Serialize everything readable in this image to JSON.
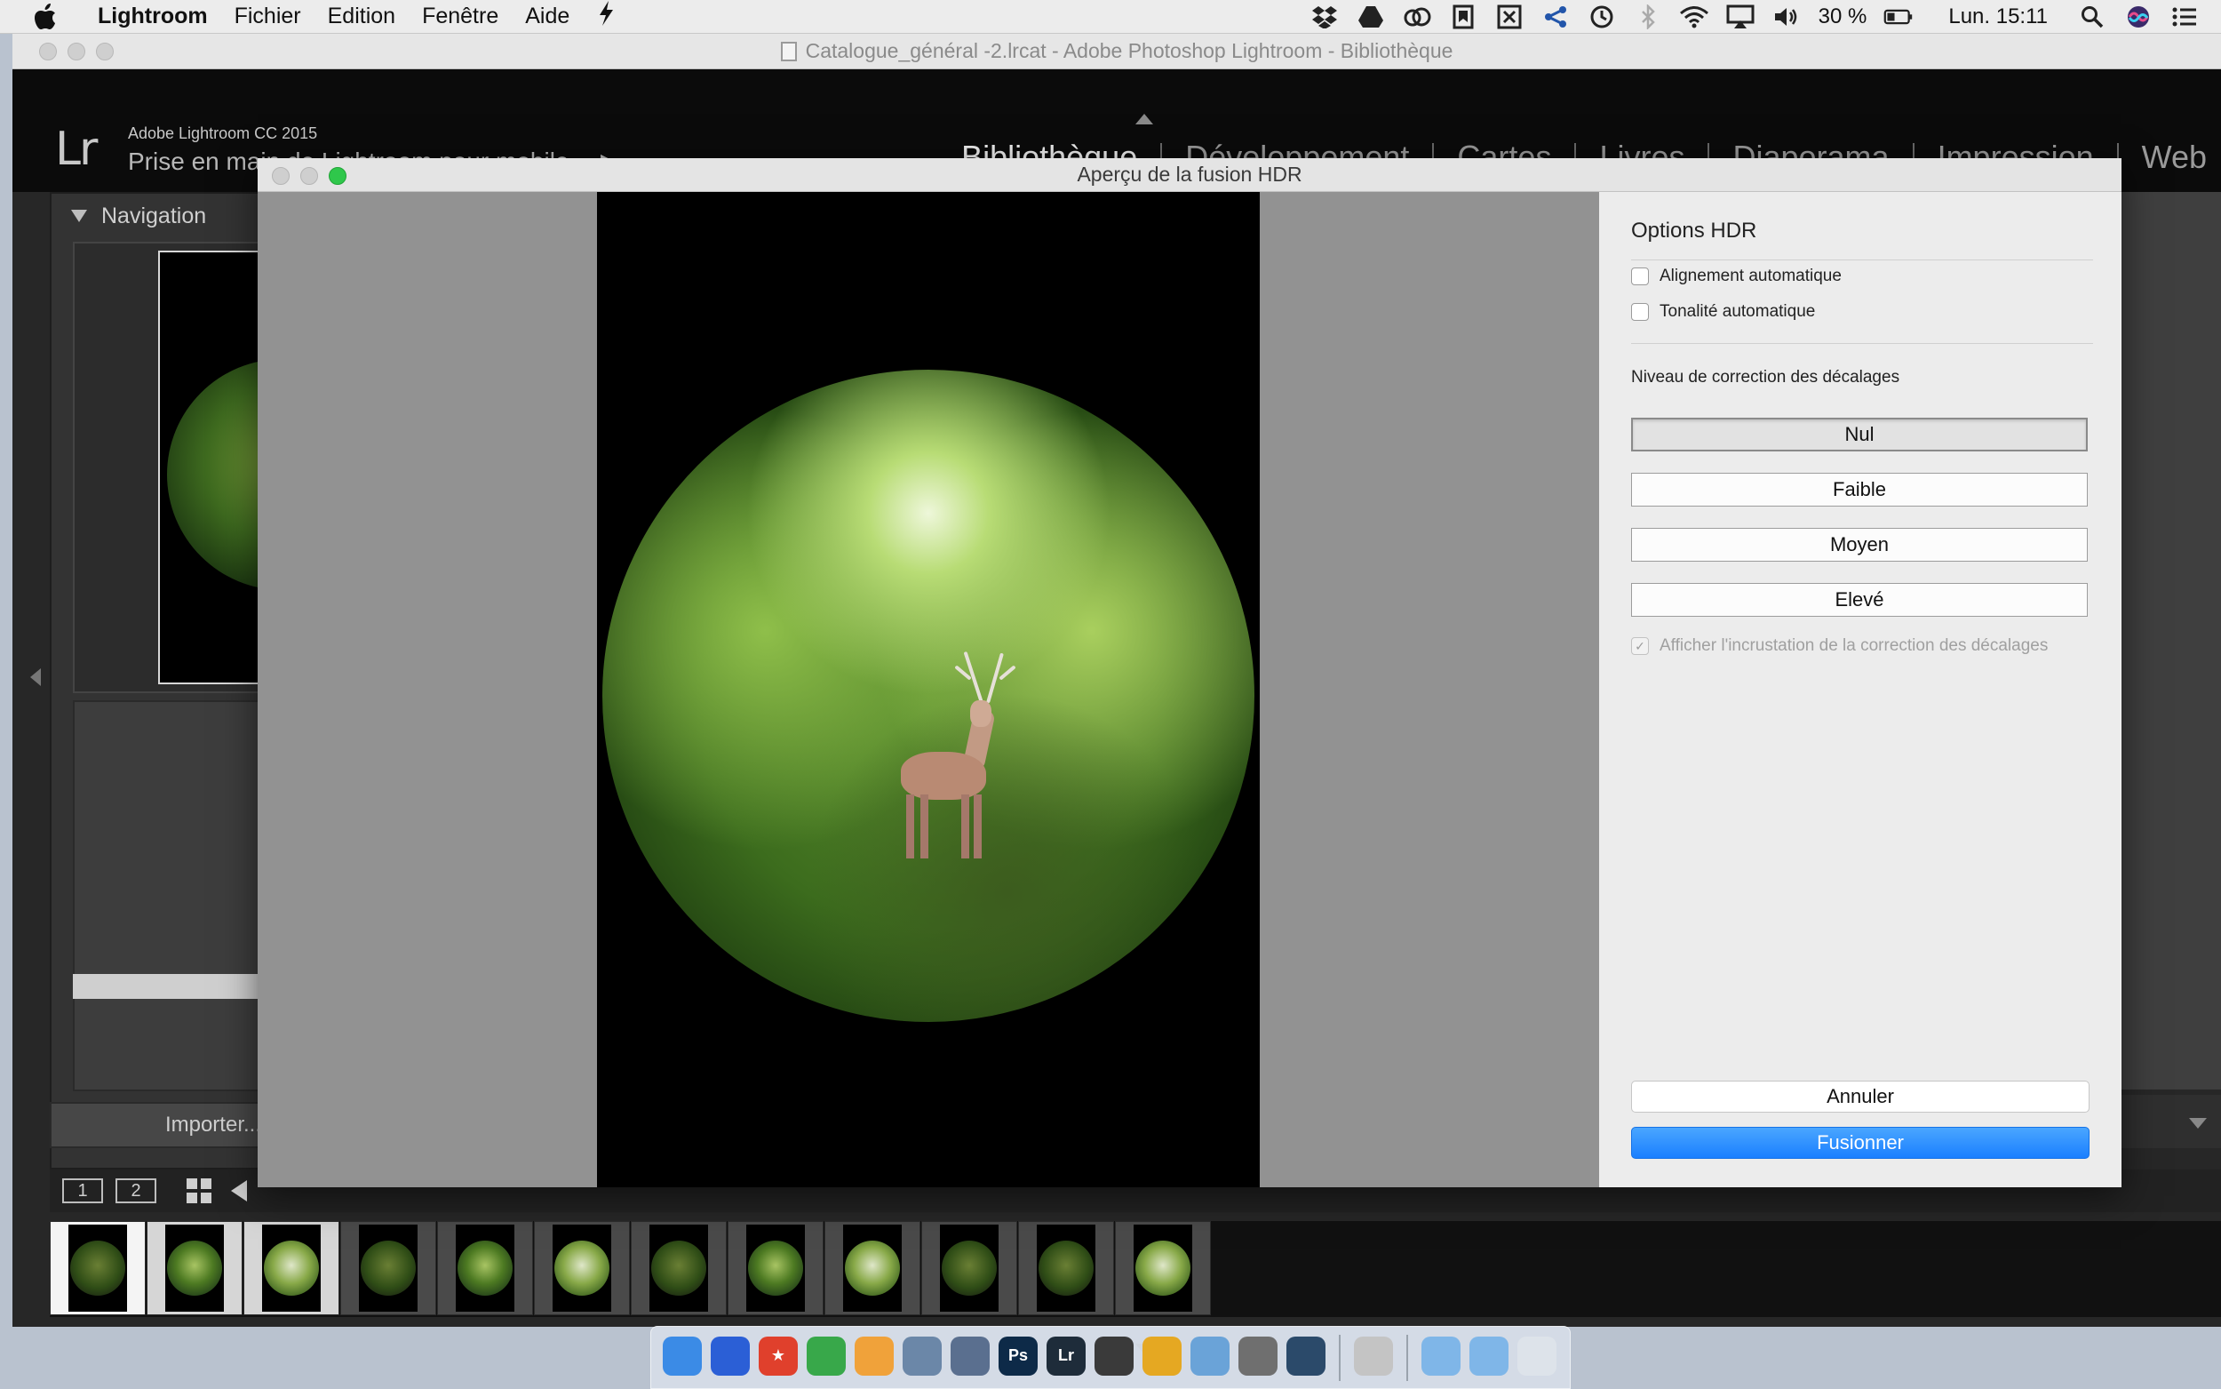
{
  "menubar": {
    "app": "Lightroom",
    "items": [
      "Fichier",
      "Edition",
      "Fenêtre",
      "Aide"
    ],
    "battery": "30 %",
    "clock": "Lun. 15:11"
  },
  "window": {
    "title": "Catalogue_général -2.lrcat - Adobe Photoshop Lightroom - Bibliothèque"
  },
  "header": {
    "logo": "Lr",
    "product": "Adobe Lightroom CC 2015",
    "identity": "Prise en main de Lightroom pour mobile",
    "arrow": "▶",
    "modules": [
      "Bibliothèque",
      "Développement",
      "Cartes",
      "Livres",
      "Diaporama",
      "Impression",
      "Web"
    ],
    "active_module": "Bibliothèque"
  },
  "left_panel": {
    "navigation_title": "Navigation",
    "import_label": "Importer..."
  },
  "filmstrip": {
    "view_buttons": [
      "1",
      "2"
    ],
    "thumbs": [
      {
        "state": "primary",
        "tone": "dark"
      },
      {
        "state": "selected",
        "tone": "normal"
      },
      {
        "state": "selected",
        "tone": "light"
      },
      {
        "state": "none",
        "tone": "dark"
      },
      {
        "state": "none",
        "tone": "normal"
      },
      {
        "state": "none",
        "tone": "light"
      },
      {
        "state": "none",
        "tone": "dark"
      },
      {
        "state": "none",
        "tone": "normal"
      },
      {
        "state": "none",
        "tone": "light"
      },
      {
        "state": "none",
        "tone": "dark"
      },
      {
        "state": "none",
        "tone": "dark"
      },
      {
        "state": "none",
        "tone": "light"
      }
    ]
  },
  "dialog": {
    "title": "Aperçu de la fusion HDR",
    "options_title": "Options HDR",
    "auto_align": "Alignement automatique",
    "auto_tone": "Tonalité automatique",
    "deghost_label": "Niveau de correction des décalages",
    "deghost_levels": [
      "Nul",
      "Faible",
      "Moyen",
      "Elevé"
    ],
    "deghost_selected": "Nul",
    "overlay_label": "Afficher l'incrustation de la correction des décalages",
    "cancel": "Annuler",
    "merge": "Fusionner"
  },
  "dock": {
    "apps": [
      {
        "name": "finder",
        "color": "#3b8be6",
        "glyph": ""
      },
      {
        "name": "screenflow",
        "color": "#2b5fd6",
        "glyph": ""
      },
      {
        "name": "bookmark",
        "color": "#e0402c",
        "glyph": "★"
      },
      {
        "name": "numbers",
        "color": "#38a84a",
        "glyph": ""
      },
      {
        "name": "pages",
        "color": "#f0a23a",
        "glyph": ""
      },
      {
        "name": "preview",
        "color": "#6b87a8",
        "glyph": ""
      },
      {
        "name": "sync",
        "color": "#5a6f8f",
        "glyph": ""
      },
      {
        "name": "photoshop",
        "color": "#0d2a48",
        "glyph": "Ps"
      },
      {
        "name": "lightroom",
        "color": "#1e2c3a",
        "glyph": "Lr"
      },
      {
        "name": "lr-mobile",
        "color": "#3a3a3a",
        "glyph": ""
      },
      {
        "name": "chrome",
        "color": "#e5a822",
        "glyph": ""
      },
      {
        "name": "mail",
        "color": "#6aa3d8",
        "glyph": ""
      },
      {
        "name": "system-prefs",
        "color": "#6f6f6f",
        "glyph": ""
      },
      {
        "name": "quicktime",
        "color": "#2b4a6a",
        "glyph": ""
      },
      {
        "name": "utility",
        "color": "#c4c4c4",
        "glyph": ""
      }
    ]
  }
}
